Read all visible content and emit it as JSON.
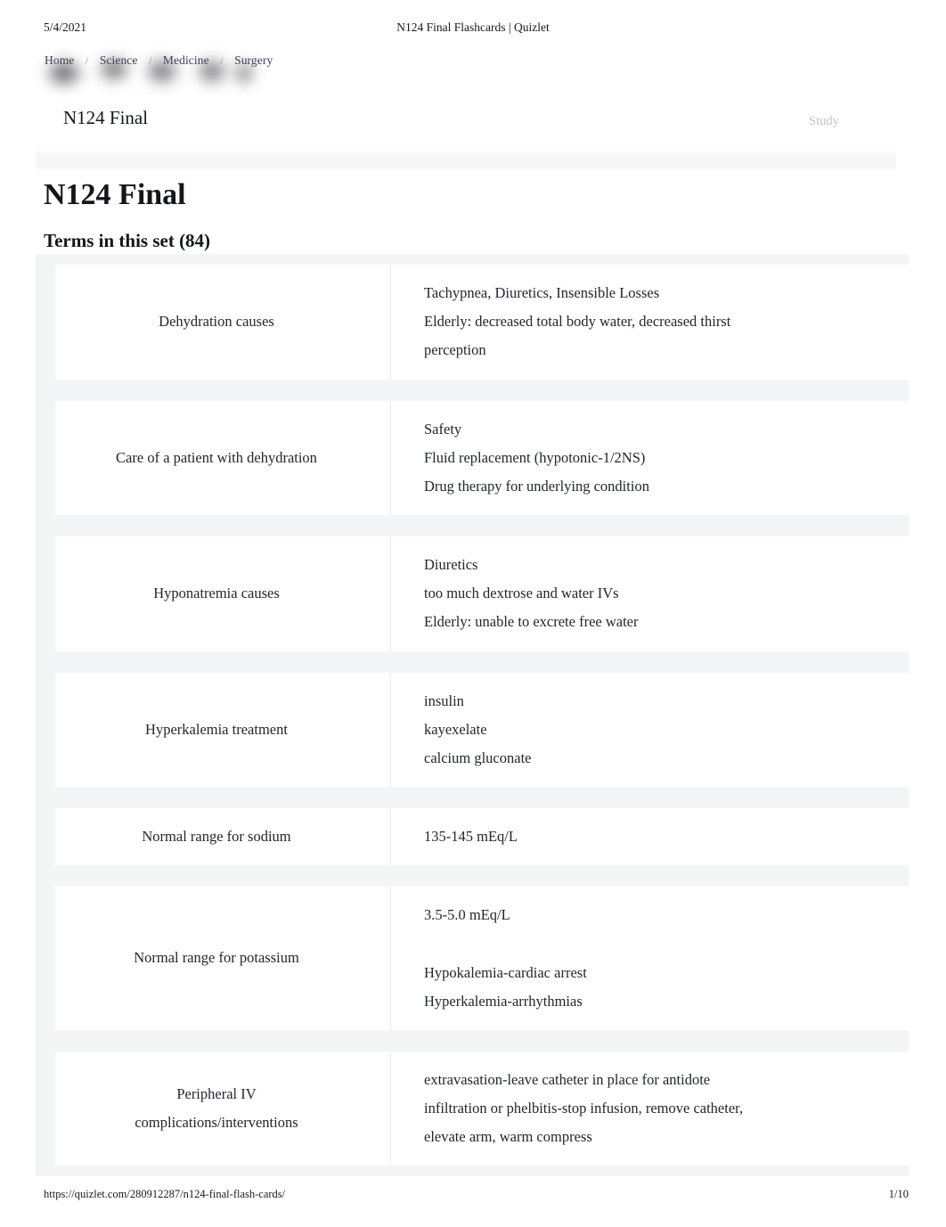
{
  "print": {
    "date": "5/4/2021",
    "document_title": "N124 Final Flashcards | Quizlet",
    "footer_url": "https://quizlet.com/280912287/n124-final-flash-cards/",
    "page_indicator": "1/10"
  },
  "site_header": {
    "breadcrumb": [
      {
        "label": "Home"
      },
      {
        "label": "Science"
      },
      {
        "label": "Medicine"
      },
      {
        "label": "Surgery"
      }
    ],
    "separator": "/",
    "set_title": "N124 Final",
    "study_label": "Study"
  },
  "main": {
    "page_title": "N124 Final",
    "terms_heading": "Terms in this set (84)",
    "terms_total": 84
  },
  "cards": [
    {
      "term": [
        "Dehydration causes"
      ],
      "definition": [
        "Tachypnea, Diuretics, Insensible Losses",
        "Elderly: decreased total body water, decreased thirst",
        "perception"
      ]
    },
    {
      "term": [
        "Care of a patient with dehydration"
      ],
      "definition": [
        "Safety",
        "Fluid replacement (hypotonic-1/2NS)",
        "Drug therapy for underlying condition"
      ]
    },
    {
      "term": [
        "Hyponatremia causes"
      ],
      "definition": [
        "Diuretics",
        "too much dextrose and water IVs",
        "Elderly: unable to excrete free water"
      ]
    },
    {
      "term": [
        "Hyperkalemia treatment"
      ],
      "definition": [
        "insulin",
        "kayexelate",
        "calcium gluconate"
      ]
    },
    {
      "term": [
        "Normal range for sodium"
      ],
      "definition": [
        "135-145 mEq/L"
      ]
    },
    {
      "term": [
        "Normal range for potassium"
      ],
      "definition": [
        "3.5-5.0 mEq/L",
        "",
        "Hypokalemia-cardiac arrest",
        "Hyperkalemia-arrhythmias"
      ]
    },
    {
      "term": [
        "Peripheral IV",
        "complications/interventions"
      ],
      "definition": [
        "extravasation-leave catheter in place for antidote",
        "infiltration or phelbitis-stop infusion, remove catheter,",
        "elevate arm, warm compress"
      ]
    }
  ],
  "colors": {
    "text": "#23262f",
    "row_background": "#f4f5f6",
    "card_background": "#ffffff",
    "muted": "#c2c4c9"
  }
}
